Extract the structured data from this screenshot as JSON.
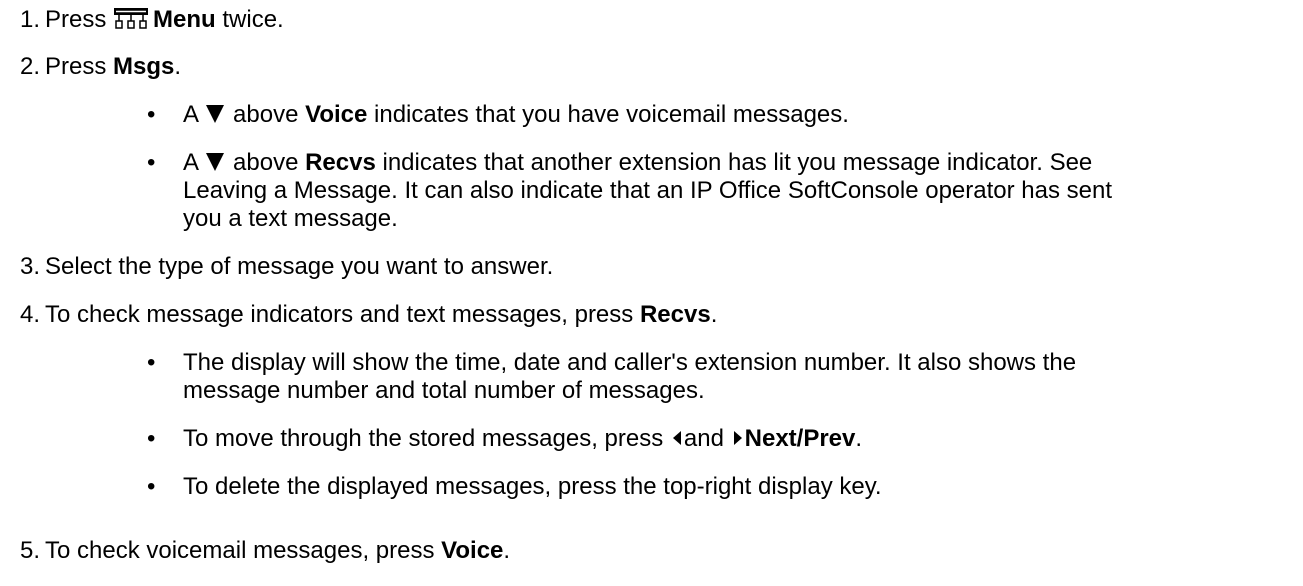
{
  "steps": [
    {
      "number": "1.",
      "before": "Press",
      "bold": "Menu",
      "after": " twice.",
      "icon": "menu-key-icon"
    },
    {
      "number": "2.",
      "before": "Press ",
      "bold": "Msgs",
      "after": "."
    },
    {
      "number": "3.",
      "text": "Select the type of message you want to answer."
    },
    {
      "number": "4.",
      "before": "To check message indicators and text messages, press ",
      "bold": "Recvs",
      "after": "."
    },
    {
      "number": "5.",
      "before": "To check voicemail messages, press ",
      "bold": "Voice",
      "after": "."
    }
  ],
  "step2_bullets": [
    {
      "before": "A",
      "icon": "down-triangle-icon",
      "mid": "above ",
      "bold": "Voice",
      "after": " indicates that you have voicemail messages."
    },
    {
      "before": "A",
      "icon": "down-triangle-icon",
      "mid": "above ",
      "bold": "Recvs",
      "lines": [
        " indicates that another extension has lit you message indicator. See",
        "Leaving a Message. It can also indicate that an IP Office SoftConsole operator has sent",
        "you a text message."
      ]
    }
  ],
  "step4_bullets": [
    {
      "lines": [
        "The display will show the time, date and caller's extension number. It also shows the",
        "message number and total number of messages."
      ]
    },
    {
      "before": "To move through the stored messages, press",
      "mid": "and",
      "bold": "Next/Prev",
      "after": ".",
      "icons": [
        "left-triangle-icon",
        "right-triangle-icon"
      ]
    },
    {
      "text": "To delete the displayed messages, press the top-right display key."
    }
  ],
  "bullet_char": "•"
}
